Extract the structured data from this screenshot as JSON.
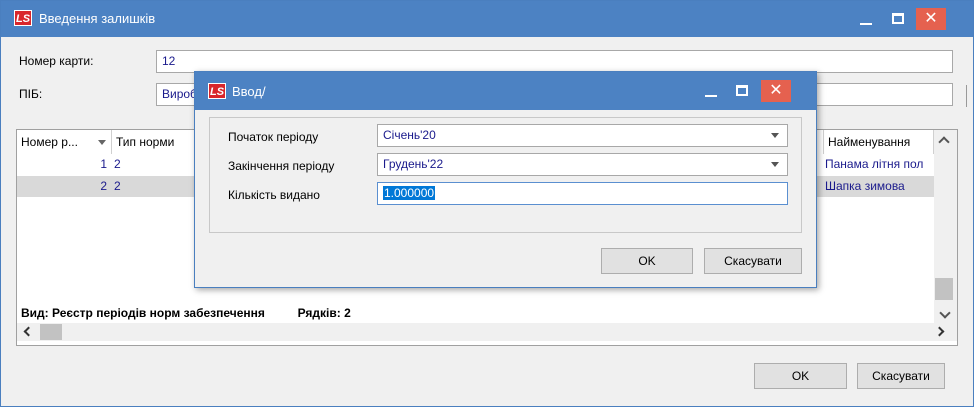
{
  "window": {
    "title": "Введення залишків",
    "logo": "LS"
  },
  "form": {
    "card_label": "Номер карти:",
    "card_value": "12",
    "pib_label": "ПІБ:",
    "pib_value": "Вироб"
  },
  "grid": {
    "columns": [
      "Номер р...",
      "Тип норми",
      "Найменування"
    ],
    "rows": [
      {
        "num": "1",
        "type": "2",
        "name": "Панама літня пол"
      },
      {
        "num": "2",
        "type": "2",
        "name": "Шапка зимова"
      }
    ],
    "status_view": "Вид: Реєстр періодів норм забезпечення",
    "status_rows": "Рядків: 2"
  },
  "buttons": {
    "ok": "OK",
    "cancel": "Скасувати"
  },
  "dialog": {
    "title": "Ввод/",
    "logo": "LS",
    "start_label": "Початок періоду",
    "start_value": "Січень'20",
    "end_label": "Закінчення періоду",
    "end_value": "Грудень'22",
    "qty_label": "Кількість видано",
    "qty_value": "1.000000",
    "ok": "OK",
    "cancel": "Скасувати"
  },
  "colors": {
    "titlebar": "#4c82c3",
    "close_button": "#e5614f",
    "value_text": "#1a1a8c",
    "selection": "#0078d7"
  }
}
